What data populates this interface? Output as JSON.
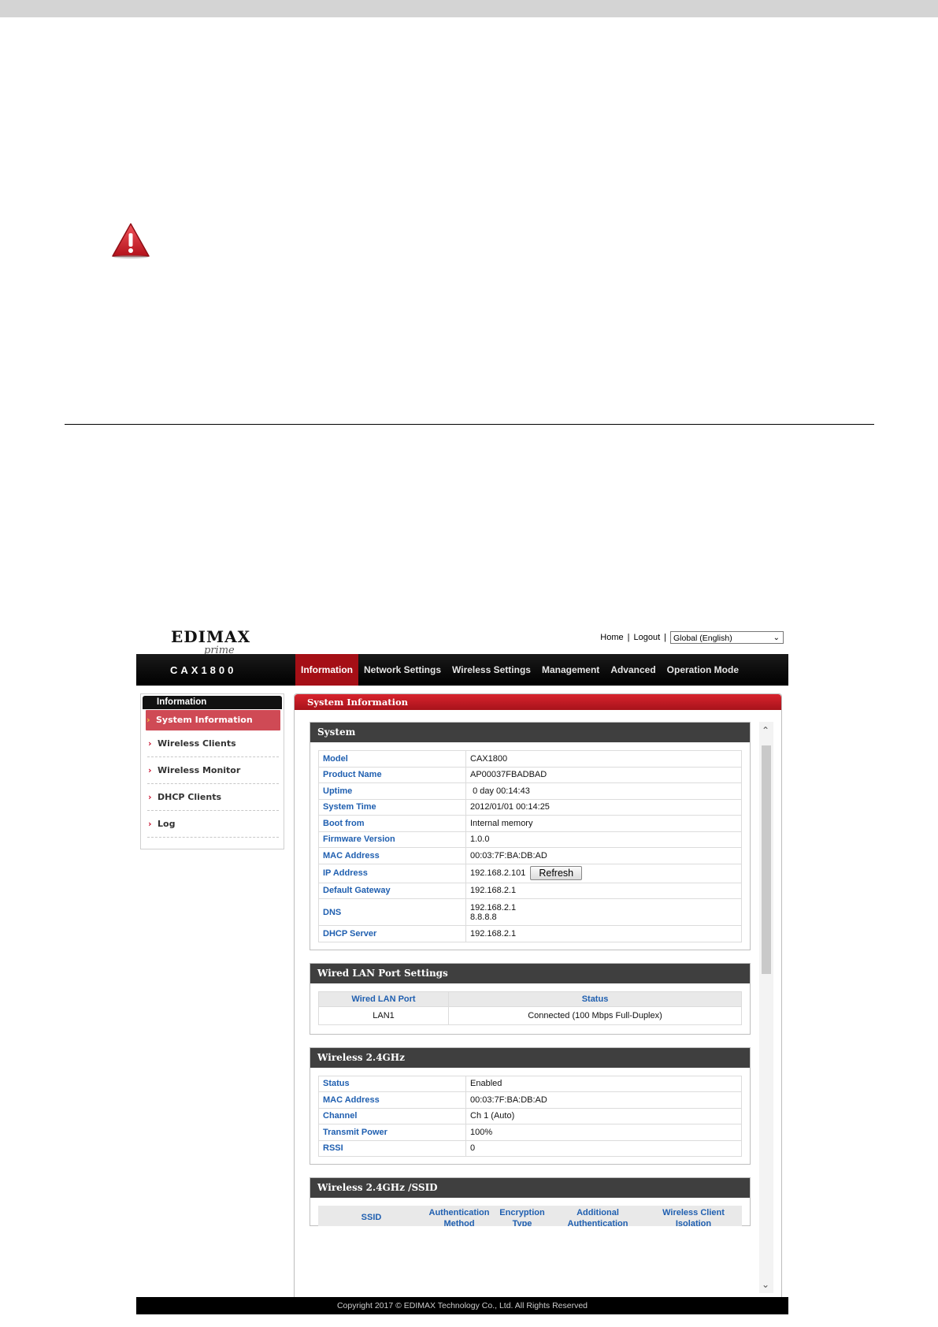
{
  "header": {
    "logo_text": "EDIMAX",
    "logo_sub": "prime",
    "home_link": "Home",
    "logout_link": "Logout",
    "link_separator": "|",
    "language": "Global (English)"
  },
  "nav": {
    "model": "CAX1800",
    "tabs": [
      {
        "label": "Information",
        "active": true
      },
      {
        "label": "Network Settings"
      },
      {
        "label": "Wireless Settings"
      },
      {
        "label": "Management"
      },
      {
        "label": "Advanced"
      },
      {
        "label": "Operation Mode"
      }
    ]
  },
  "sidebar": {
    "title": "Information",
    "items": [
      {
        "label": "System Information",
        "active": true
      },
      {
        "label": "Wireless Clients"
      },
      {
        "label": "Wireless Monitor"
      },
      {
        "label": "DHCP Clients"
      },
      {
        "label": "Log"
      }
    ]
  },
  "panel": {
    "title": "System Information"
  },
  "system": {
    "title": "System",
    "rows": [
      {
        "key": "Model",
        "value": "CAX1800"
      },
      {
        "key": "Product Name",
        "value": "AP00037FBADBAD"
      },
      {
        "key": "Uptime",
        "value": "0 day 00:14:43"
      },
      {
        "key": "System Time",
        "value": "2012/01/01 00:14:25"
      },
      {
        "key": "Boot from",
        "value": "Internal memory"
      },
      {
        "key": "Firmware Version",
        "value": "1.0.0"
      },
      {
        "key": "MAC Address",
        "value": "00:03:7F:BA:DB:AD"
      },
      {
        "key": "IP Address",
        "value": "192.168.2.101",
        "button": "Refresh"
      },
      {
        "key": "Default Gateway",
        "value": "192.168.2.1"
      },
      {
        "key": "DNS",
        "value": "192.168.2.1",
        "value2": "8.8.8.8"
      },
      {
        "key": "DHCP Server",
        "value": "192.168.2.1"
      }
    ]
  },
  "wired": {
    "title": "Wired LAN Port Settings",
    "columns": [
      "Wired LAN Port",
      "Status"
    ],
    "rows": [
      [
        "LAN1",
        "Connected (100 Mbps Full-Duplex)"
      ]
    ]
  },
  "wireless24": {
    "title": "Wireless 2.4GHz",
    "rows": [
      {
        "key": "Status",
        "value": "Enabled"
      },
      {
        "key": "MAC Address",
        "value": "00:03:7F:BA:DB:AD"
      },
      {
        "key": "Channel",
        "value": "Ch 1 (Auto)"
      },
      {
        "key": "Transmit Power",
        "value": "100%"
      },
      {
        "key": "RSSI",
        "value": "0"
      }
    ]
  },
  "ssid": {
    "title": "Wireless 2.4GHz /SSID",
    "columns": [
      "SSID",
      "Authentication Method",
      "Encryption Type",
      "Additional Authentication",
      "Wireless Client Isolation"
    ]
  },
  "footer": {
    "copyright": "Copyright 2017 © EDIMAX Technology Co., Ltd. All Rights Reserved"
  },
  "colors": {
    "accent_red": "#a50f16",
    "label_blue": "#1f5fb0",
    "section_head": "#3f3f3f"
  }
}
